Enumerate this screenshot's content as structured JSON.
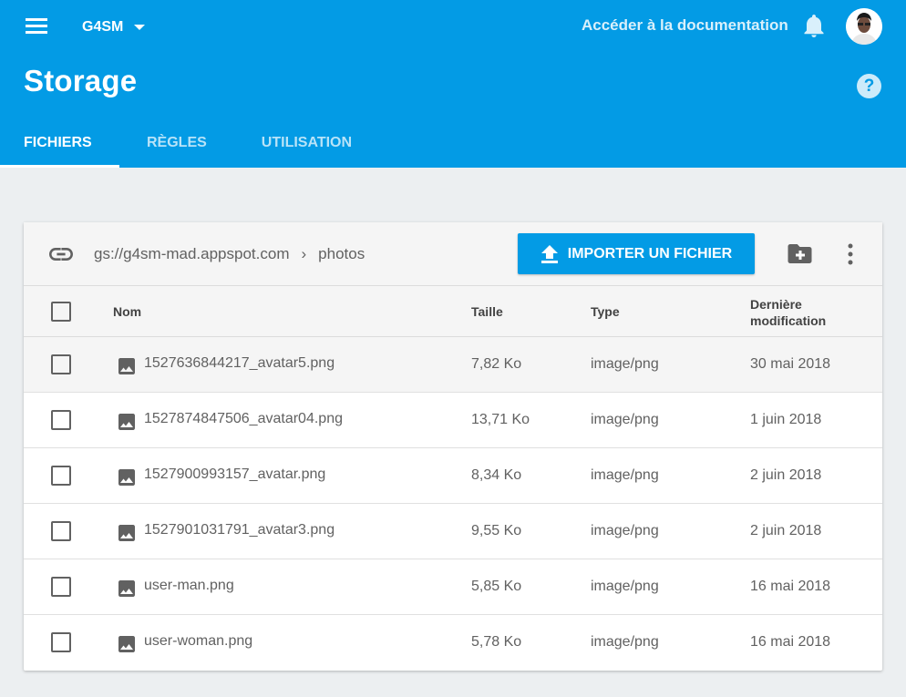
{
  "header": {
    "project": "G4SM",
    "doc_link": "Accéder à la documentation",
    "title": "Storage",
    "help_glyph": "?",
    "tabs": [
      {
        "label": "FICHIERS",
        "active": true
      },
      {
        "label": "RÈGLES",
        "active": false
      },
      {
        "label": "UTILISATION",
        "active": false
      }
    ],
    "brand_color": "#039be5"
  },
  "toolbar": {
    "bucket": "gs://g4sm-mad.appspot.com",
    "separator": "›",
    "folder": "photos",
    "upload_label": "IMPORTER UN FICHIER"
  },
  "table": {
    "columns": {
      "name": "Nom",
      "size": "Taille",
      "type": "Type",
      "modified_line1": "Dernière",
      "modified_line2": "modification"
    },
    "rows": [
      {
        "name": "1527636844217_avatar5.png",
        "size": "7,82 Ko",
        "type": "image/png",
        "modified": "30 mai 2018"
      },
      {
        "name": "1527874847506_avatar04.png",
        "size": "13,71 Ko",
        "type": "image/png",
        "modified": "1 juin 2018"
      },
      {
        "name": "1527900993157_avatar.png",
        "size": "8,34 Ko",
        "type": "image/png",
        "modified": "2 juin 2018"
      },
      {
        "name": "1527901031791_avatar3.png",
        "size": "9,55 Ko",
        "type": "image/png",
        "modified": "2 juin 2018"
      },
      {
        "name": "user-man.png",
        "size": "5,85 Ko",
        "type": "image/png",
        "modified": "16 mai 2018"
      },
      {
        "name": "user-woman.png",
        "size": "5,78 Ko",
        "type": "image/png",
        "modified": "16 mai 2018"
      }
    ]
  }
}
